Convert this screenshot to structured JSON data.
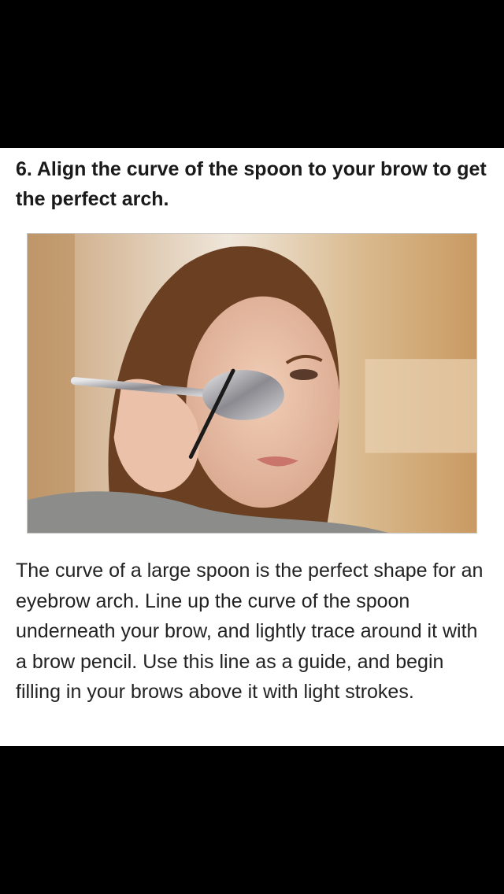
{
  "step": {
    "title": "6. Align the curve of the spoon to your brow to get the perfect arch."
  },
  "photo": {
    "icon": "photo-woman-spoon-brow"
  },
  "body": {
    "text": "The curve of a large spoon is the perfect shape for an eyebrow arch. Line up the curve of the spoon underneath your brow, and lightly trace around it with a brow pencil. Use this line as a guide, and begin filling in your brows above it with light strokes."
  },
  "colors": {
    "background": "#000000",
    "card": "#ffffff",
    "text": "#1a1a1a"
  }
}
